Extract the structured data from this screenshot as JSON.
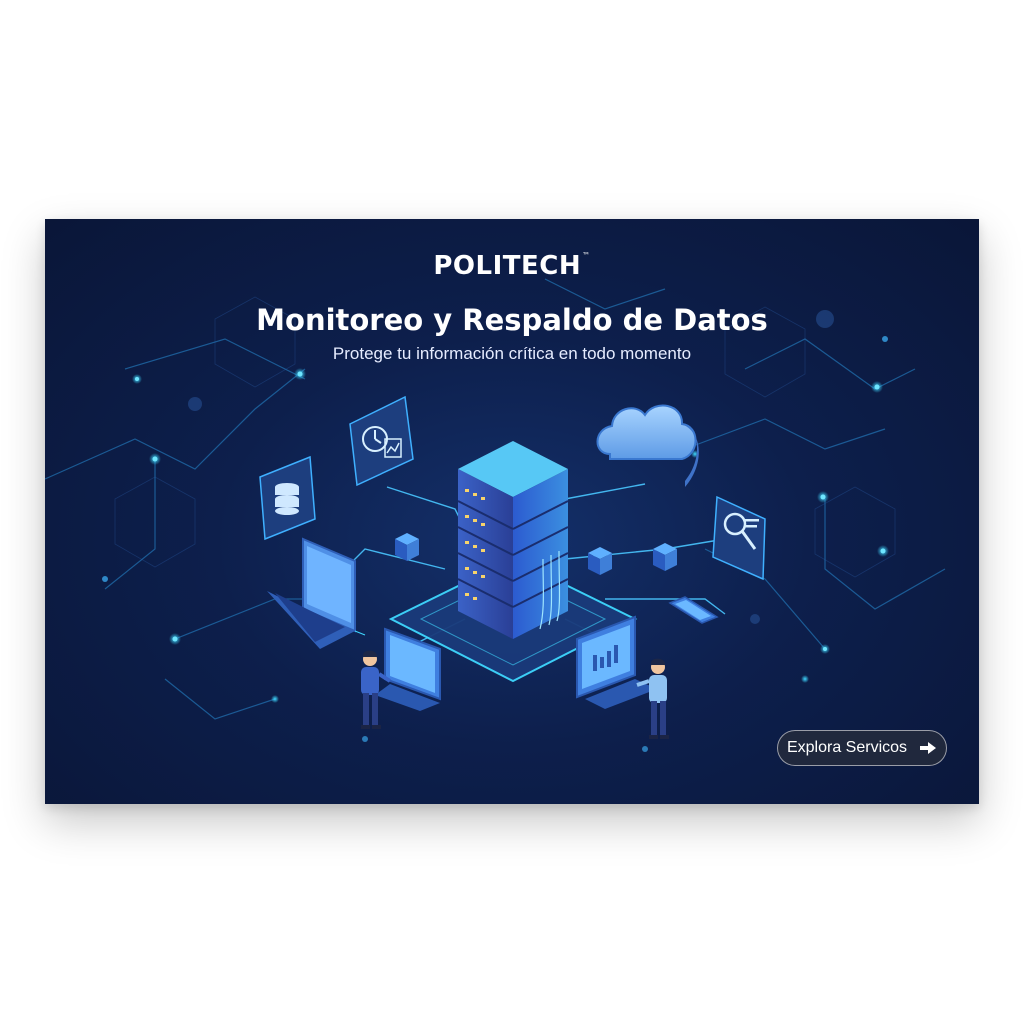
{
  "brand": {
    "name": "POLITECH",
    "mark": "™"
  },
  "hero": {
    "title": "Monitoreo y Respaldo de Datos",
    "subtitle": "Protege tu información crítica en todo momento"
  },
  "cta": {
    "label": "Explora Servicos",
    "icon": "arrow-right-icon"
  },
  "colors": {
    "background": "#0d1f4c",
    "accent_cyan": "#2fd6ff",
    "server_blue": "#3a7bd5",
    "cloud_light": "#7fb8f5"
  },
  "illustration": {
    "icons": [
      "database-icon",
      "clock-chart-icon",
      "cloud-icon",
      "search-document-icon",
      "server-rack-icon",
      "laptop-icon",
      "monitor-icon",
      "phone-icon",
      "person-icon"
    ]
  }
}
